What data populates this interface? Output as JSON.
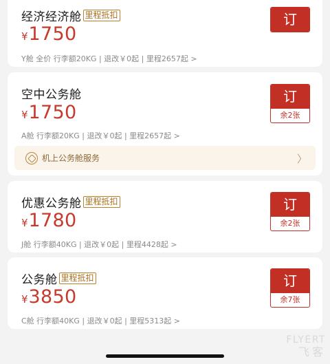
{
  "fares": [
    {
      "name": "经济经济舱",
      "badge": "里程抵扣",
      "currency": "¥",
      "price": "1750",
      "meta": "Y舱 全价  行李额20KG | 退改￥0起 | 里程2657起 >",
      "book_label": "订",
      "remaining": ""
    },
    {
      "name": "空中公务舱",
      "badge": "",
      "currency": "¥",
      "price": "1750",
      "meta": "A舱   行李额20KG | 退改￥0起 | 里程2657起 >",
      "book_label": "订",
      "remaining": "余2张",
      "service_label": "机上公务舱服务",
      "service_icon": "service-badge-icon"
    },
    {
      "name": "优惠公务舱",
      "badge": "里程抵扣",
      "currency": "¥",
      "price": "1780",
      "meta": "J舱   行李额40KG | 退改￥0起 | 里程4428起 >",
      "book_label": "订",
      "remaining": "余2张"
    },
    {
      "name": "公务舱",
      "badge": "里程抵扣",
      "currency": "¥",
      "price": "3850",
      "meta": "C舱   行李额40KG | 退改￥0起 | 里程5313起 >",
      "book_label": "订",
      "remaining": "余7张"
    }
  ],
  "watermark": {
    "line1": "FLYERT",
    "line2": "飞客"
  },
  "colors": {
    "accent": "#c22f24",
    "price": "#c53a2b",
    "badge": "#a8701f",
    "background": "#f3f3f4"
  }
}
